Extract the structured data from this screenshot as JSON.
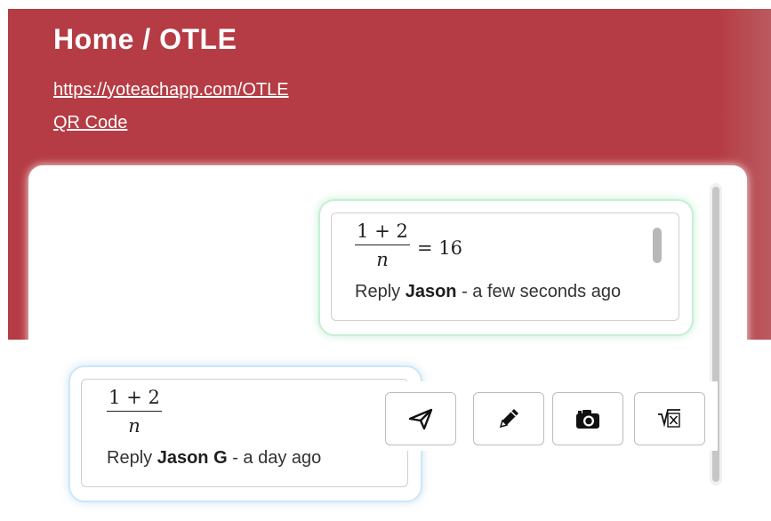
{
  "header": {
    "title": "Home / OTLE",
    "url_link": "https://yoteachapp.com/OTLE",
    "qr_link": "QR Code"
  },
  "messages": [
    {
      "math": {
        "numerator": "1 + 2",
        "denominator": "n",
        "rhs": "= 16"
      },
      "reply_label": "Reply",
      "author": "Jason",
      "time": "- a few seconds ago"
    },
    {
      "math": {
        "numerator": "1 + 2",
        "denominator": "n"
      },
      "reply_label": "Reply",
      "author": "Jason G",
      "time": "- a day ago"
    }
  ],
  "toolbar": {
    "buttons": [
      {
        "icon": "send-icon"
      },
      {
        "icon": "pencil-icon"
      },
      {
        "icon": "camera-icon"
      },
      {
        "icon": "formula-icon"
      }
    ]
  },
  "colors": {
    "header_bg": "#b53c44",
    "mine_border": "#c6efd4",
    "theirs_border": "#cde6f7"
  }
}
